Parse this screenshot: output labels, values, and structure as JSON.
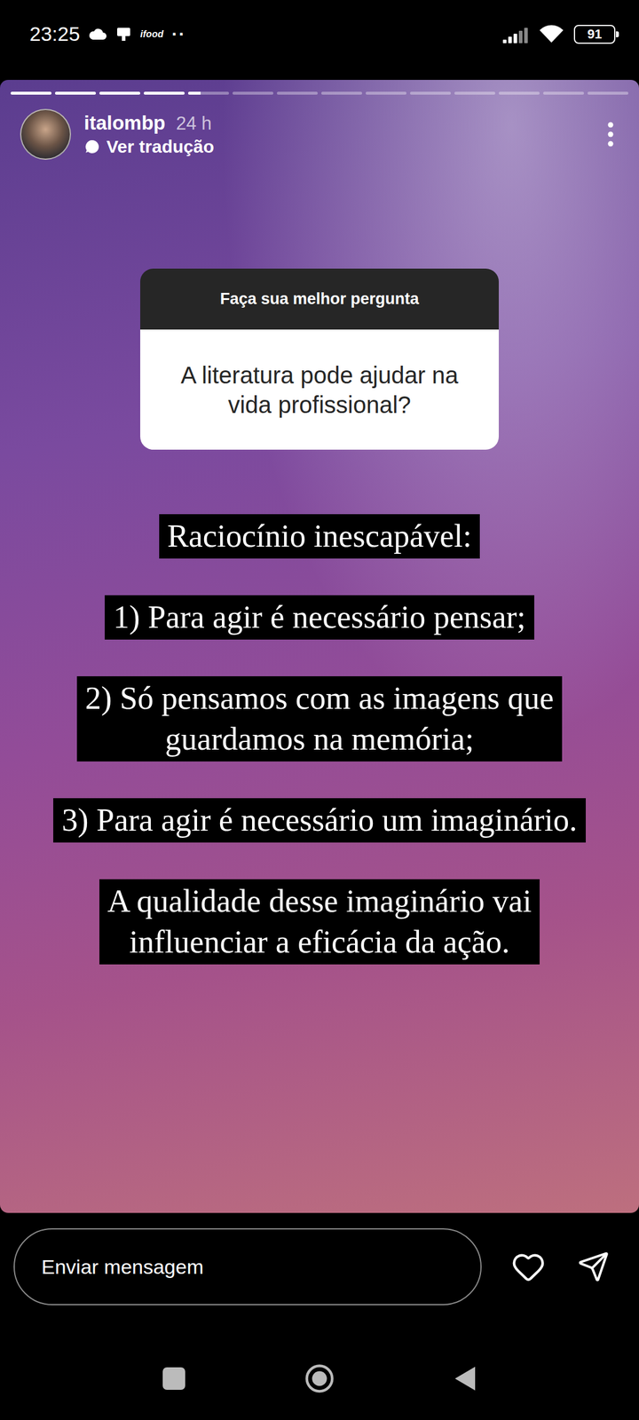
{
  "status_bar": {
    "time": "23:25",
    "notifications": [
      "ifood"
    ],
    "more": "··",
    "battery": "91"
  },
  "story": {
    "progress": [
      1,
      1,
      1,
      1,
      0.3,
      0,
      0,
      0,
      0,
      0,
      0,
      0,
      0,
      0
    ],
    "user": {
      "name": "italombp",
      "age": "24 h"
    },
    "translate": "Ver tradução",
    "question": {
      "prompt": "Faça sua melhor pergunta",
      "text": "A literatura pode ajudar na vida profissional?"
    },
    "captions": [
      {
        "lines": [
          "Raciocínio inescapável:"
        ]
      },
      {
        "lines": [
          "1) Para agir é necessário pensar;"
        ]
      },
      {
        "lines": [
          "2) Só pensamos com as imagens que",
          "guardamos na memória;"
        ]
      },
      {
        "lines": [
          "3) Para agir é necessário um imaginário."
        ]
      },
      {
        "lines": [
          "A qualidade desse imaginário vai",
          "influenciar a eficácia da ação."
        ]
      }
    ]
  },
  "reply": {
    "placeholder": "Enviar mensagem"
  }
}
